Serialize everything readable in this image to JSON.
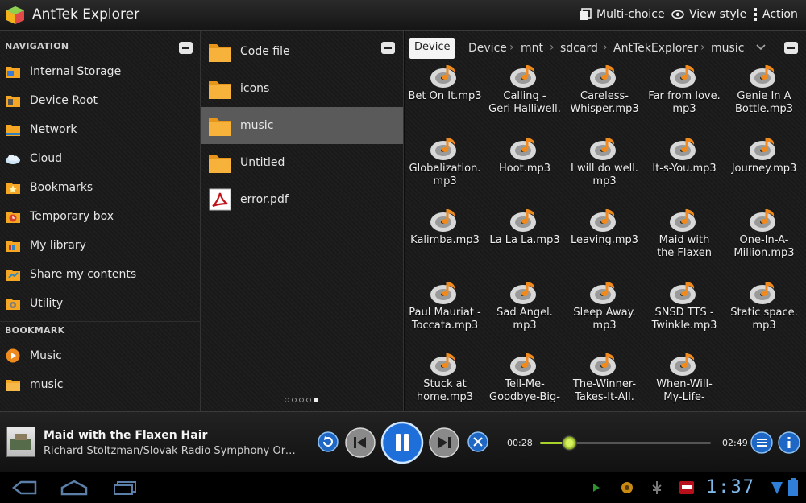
{
  "app": {
    "title": "AntTek Explorer"
  },
  "actionbar": {
    "multi_choice": "Multi-choice",
    "view_style": "View style",
    "action": "Action"
  },
  "navigation": {
    "header": "NAVIGATION",
    "items": [
      {
        "label": "Internal Storage",
        "icon": "storage-folder-icon"
      },
      {
        "label": "Device Root",
        "icon": "device-folder-icon"
      },
      {
        "label": "Network",
        "icon": "network-folder-icon"
      },
      {
        "label": "Cloud",
        "icon": "cloud-icon"
      },
      {
        "label": "Bookmarks",
        "icon": "bookmark-star-icon"
      },
      {
        "label": "Temporary box",
        "icon": "clock-folder-icon"
      },
      {
        "label": "My library",
        "icon": "library-folder-icon"
      },
      {
        "label": "Share my contents",
        "icon": "share-folder-icon"
      },
      {
        "label": "Utility",
        "icon": "utility-gear-icon"
      }
    ]
  },
  "bookmark": {
    "header": "BOOKMARK",
    "items": [
      {
        "label": "Music",
        "icon": "play-circle-icon"
      },
      {
        "label": "music",
        "icon": "folder-icon"
      }
    ]
  },
  "folders": {
    "items": [
      {
        "label": "Code file",
        "icon": "folder-icon"
      },
      {
        "label": "icons",
        "icon": "folder-icon"
      },
      {
        "label": "music",
        "icon": "folder-icon",
        "selected": true
      },
      {
        "label": "Untitled",
        "icon": "folder-icon"
      },
      {
        "label": "error.pdf",
        "icon": "pdf-icon"
      }
    ],
    "page_count": 5,
    "active_page": 5
  },
  "breadcrumb": {
    "current": "Device",
    "path": [
      "Device",
      "mnt",
      "sdcard",
      "AntTekExplorer",
      "music"
    ]
  },
  "files": [
    {
      "line1": "Bet On It.mp3",
      "line2": ""
    },
    {
      "line1": "Calling  -",
      "line2": "Geri Halliwell."
    },
    {
      "line1": "Careless-",
      "line2": "Whisper.mp3"
    },
    {
      "line1": "Far from love.",
      "line2": "mp3"
    },
    {
      "line1": "Genie In A",
      "line2": "Bottle.mp3"
    },
    {
      "line1": "Globalization.",
      "line2": "mp3"
    },
    {
      "line1": "Hoot.mp3",
      "line2": ""
    },
    {
      "line1": "I will do well.",
      "line2": "mp3"
    },
    {
      "line1": "It-s-You.mp3",
      "line2": ""
    },
    {
      "line1": "Journey.mp3",
      "line2": ""
    },
    {
      "line1": "Kalimba.mp3",
      "line2": ""
    },
    {
      "line1": "La La La.mp3",
      "line2": ""
    },
    {
      "line1": "Leaving.mp3",
      "line2": ""
    },
    {
      "line1": "Maid with",
      "line2": "the Flaxen"
    },
    {
      "line1": "One-In-A-",
      "line2": "Million.mp3"
    },
    {
      "line1": "Paul Mauriat -",
      "line2": "Toccata.mp3"
    },
    {
      "line1": "Sad Angel.",
      "line2": "mp3"
    },
    {
      "line1": "Sleep Away.",
      "line2": "mp3"
    },
    {
      "line1": "SNSD TTS -",
      "line2": "Twinkle.mp3"
    },
    {
      "line1": "Static space.",
      "line2": "mp3"
    },
    {
      "line1": "Stuck at",
      "line2": "home.mp3"
    },
    {
      "line1": "Tell-Me-",
      "line2": "Goodbye-Big-"
    },
    {
      "line1": "The-Winner-",
      "line2": "Takes-It-All."
    },
    {
      "line1": "When-Will-",
      "line2": "My-Life-"
    }
  ],
  "player": {
    "title": "Maid with the Flaxen Hair",
    "artist": "Richard Stoltzman/Slovak Radio Symphony Orc...",
    "elapsed": "00:28",
    "duration": "02:49",
    "progress": 0.17
  },
  "system": {
    "clock": "1:37"
  },
  "colors": {
    "accent_blue": "#2f7fd8",
    "seek_green": "#a8d22a",
    "folder_orange": "#f5a623",
    "music_orange": "#f08a1c"
  }
}
